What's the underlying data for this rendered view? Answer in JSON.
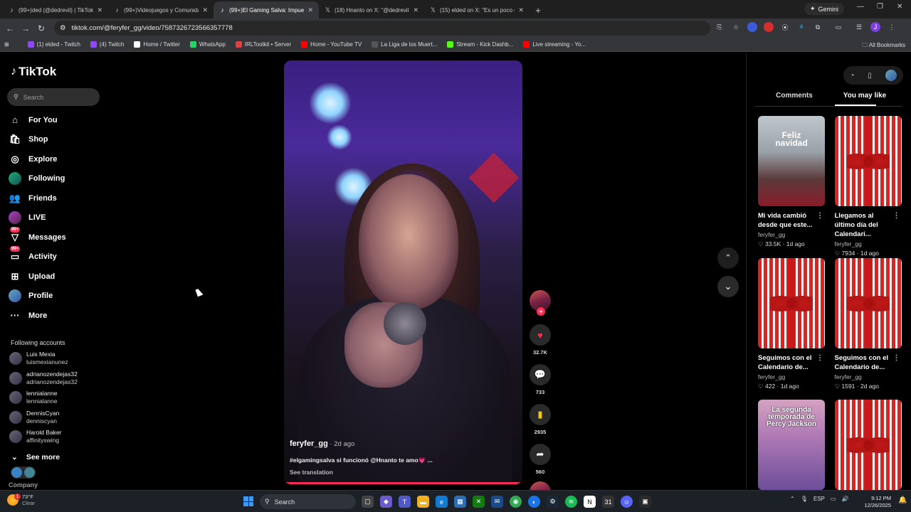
{
  "browser": {
    "tabs": [
      {
        "icon": "tiktok-icon",
        "title": "(99+)ded (@dedrevil) | TikTok"
      },
      {
        "icon": "tiktok-icon",
        "title": "(99+)Videojuegos y Comunidad"
      },
      {
        "icon": "tiktok-icon",
        "title": "(99+)El Gaming Salva: Impuest",
        "active": true
      },
      {
        "icon": "x-icon",
        "title": "(18) Hnanto on X: \"@dedrevil I"
      },
      {
        "icon": "x-icon",
        "title": "(15) elded on X: \"Es un poco de"
      }
    ],
    "new_tab": "+",
    "gemini_label": "Gemini",
    "url": "tiktok.com/@feryfer_gg/video/7587326723566357778",
    "bookmarks": [
      {
        "icon": "twitch-icon",
        "color": "#9146ff",
        "label": "(1) elded - Twitch"
      },
      {
        "icon": "twitch-icon",
        "color": "#9146ff",
        "label": "(4) Twitch"
      },
      {
        "icon": "x-icon",
        "color": "#ffffff",
        "label": "Home / Twitter"
      },
      {
        "icon": "whatsapp-icon",
        "color": "#25d366",
        "label": "WhatsApp"
      },
      {
        "icon": "irl-icon",
        "color": "#e04040",
        "label": "IRLToolkit • Server"
      },
      {
        "icon": "youtube-icon",
        "color": "#ff0000",
        "label": "Home - YouTube TV"
      },
      {
        "icon": "liga-icon",
        "color": "#555555",
        "label": "La Liga de los Muert..."
      },
      {
        "icon": "kick-icon",
        "color": "#53fc18",
        "label": "Stream - Kick Dashb..."
      },
      {
        "icon": "youtube-icon",
        "color": "#ff0000",
        "label": "Live streaming - Yo..."
      }
    ],
    "all_bookmarks": "All Bookmarks"
  },
  "tiktok": {
    "logo": "TikTok",
    "search_placeholder": "Search",
    "nav": [
      {
        "icon": "home-icon",
        "glyph": "⌂",
        "label": "For You"
      },
      {
        "icon": "shop-icon",
        "glyph": "🛍",
        "label": "Shop"
      },
      {
        "icon": "compass-icon",
        "glyph": "◎",
        "label": "Explore"
      },
      {
        "icon": "following-avatar-icon",
        "glyph": "●",
        "label": "Following"
      },
      {
        "icon": "friends-icon",
        "glyph": "👥",
        "label": "Friends"
      },
      {
        "icon": "live-avatar-icon",
        "glyph": "●",
        "label": "LIVE"
      },
      {
        "icon": "messages-icon",
        "glyph": "▽",
        "label": "Messages",
        "badge": "99+"
      },
      {
        "icon": "activity-icon",
        "glyph": "▭",
        "label": "Activity",
        "badge": "99+"
      },
      {
        "icon": "upload-icon",
        "glyph": "⊞",
        "label": "Upload"
      },
      {
        "icon": "profile-avatar-icon",
        "glyph": "●",
        "label": "Profile"
      },
      {
        "icon": "more-icon",
        "glyph": "···",
        "label": "More"
      }
    ],
    "following_title": "Following accounts",
    "following": [
      {
        "name": "Luis Mexia",
        "handle": "luismexianunez"
      },
      {
        "name": "adrianozendejas32",
        "handle": "adrianozendejas32"
      },
      {
        "name": "lennialanne",
        "handle": "lennialanne"
      },
      {
        "name": "DennisCyan",
        "handle": "denniscyan"
      },
      {
        "name": "Harold Baker",
        "handle": "affinityswing"
      }
    ],
    "see_more": "See more",
    "company": "Company"
  },
  "video": {
    "author": "feryfer_gg",
    "date": " · 2d ago",
    "caption": "#elgamingsalva si funcionó @Hnanto te amo💗 ...",
    "see_translation": "See translation",
    "likes": "32.7K",
    "comments": "733",
    "saves": "2935",
    "shares": "560"
  },
  "panel": {
    "tab_comments": "Comments",
    "tab_you_may_like": "You may like",
    "cards": [
      {
        "thumb": "xmas",
        "thumb_text": "Feliz navidad",
        "title": "Mi vida cambió desde que este...",
        "author": "feryfer_gg",
        "likes": "33.5K",
        "age": "1d ago"
      },
      {
        "thumb": "gift",
        "title": "Llegamos al último día del Calendari...",
        "author": "feryfer_gg",
        "likes": "7934",
        "age": "1d ago"
      },
      {
        "thumb": "gift",
        "title": "Seguimos con el Calendario de...",
        "author": "feryfer_gg",
        "likes": "422",
        "age": "1d ago"
      },
      {
        "thumb": "gift",
        "title": "Seguimos con el Calendario de...",
        "author": "feryfer_gg",
        "likes": "1591",
        "age": "2d ago"
      },
      {
        "thumb": "percy",
        "thumb_text": "La segunda temporada de Percy Jackson",
        "title": "",
        "author": "",
        "likes": "",
        "age": ""
      },
      {
        "thumb": "gift",
        "title": "",
        "author": "",
        "likes": "",
        "age": ""
      }
    ]
  },
  "taskbar": {
    "temp": "73°F",
    "condition": "Clear",
    "search": "Search",
    "lang": "ESP",
    "time": "9:12 PM",
    "date": "12/26/2025",
    "weather_badge": "1"
  },
  "colors": {
    "accent": "#fe2c55",
    "page_bg": "#000000"
  }
}
